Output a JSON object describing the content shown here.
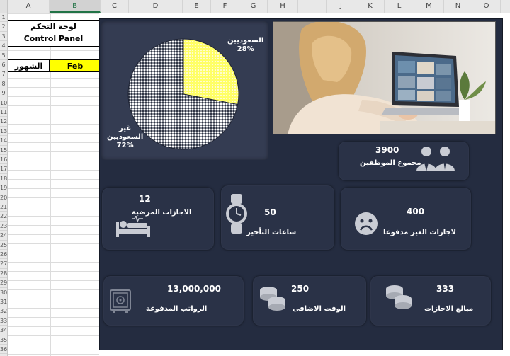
{
  "sheet": {
    "columns": [
      "A",
      "B",
      "C",
      "D",
      "E",
      "F",
      "G",
      "H",
      "I",
      "J",
      "K",
      "L",
      "M",
      "N",
      "O"
    ],
    "rows": [
      "1",
      "2",
      "3",
      "4",
      "5",
      "6",
      "7",
      "8",
      "9",
      "10",
      "11",
      "12",
      "13",
      "14",
      "15",
      "16",
      "17",
      "18",
      "19",
      "20",
      "21",
      "22",
      "23",
      "24",
      "25",
      "26",
      "27",
      "28",
      "29",
      "30",
      "31",
      "32",
      "33",
      "34",
      "35",
      "36"
    ]
  },
  "control_panel": {
    "title_ar": "لوحة التحكم",
    "title_en": "Control Panel",
    "month_label": "الشهور",
    "month_value": "Feb",
    "dropdown_glyph": "▼"
  },
  "chart_data": {
    "type": "pie",
    "categories": [
      "السعوديين",
      "غير السعوديين"
    ],
    "values": [
      28,
      72
    ],
    "labels": {
      "saudi_name": "السعوديين",
      "saudi_pct": "28%",
      "non_saudi_line1": "غير",
      "non_saudi_line2": "السعوديين",
      "non_saudi_pct": "72%"
    },
    "colors": [
      "#ffff88",
      "#8b8f99"
    ]
  },
  "kpis": {
    "employees": {
      "value": "3900",
      "label": "مجموع الموظفين",
      "icon": "employees-icon"
    },
    "sick_leave": {
      "value": "12",
      "label": "الاجازات المرضية",
      "icon": "hospital-bed-icon"
    },
    "late_hours": {
      "value": "50",
      "label": "ساعات التأخير",
      "icon": "watch-icon"
    },
    "unpaid_leave": {
      "value": "400",
      "label": "لاجازات الغير مدفوعا",
      "icon": "sad-face-icon"
    },
    "salaries": {
      "value": "13,000,000",
      "label": "الرواتب المدفوعة",
      "icon": "safe-icon"
    },
    "overtime": {
      "value": "250",
      "label": "الوقت الاضافى",
      "icon": "coins-icon"
    },
    "leave_amounts": {
      "value": "333",
      "label": "مبالغ الاجازات",
      "icon": "coins-icon"
    }
  },
  "colors": {
    "dashboard_bg": "#242c40",
    "card_bg": "#2a3247",
    "accent_yellow": "#ffff00"
  }
}
